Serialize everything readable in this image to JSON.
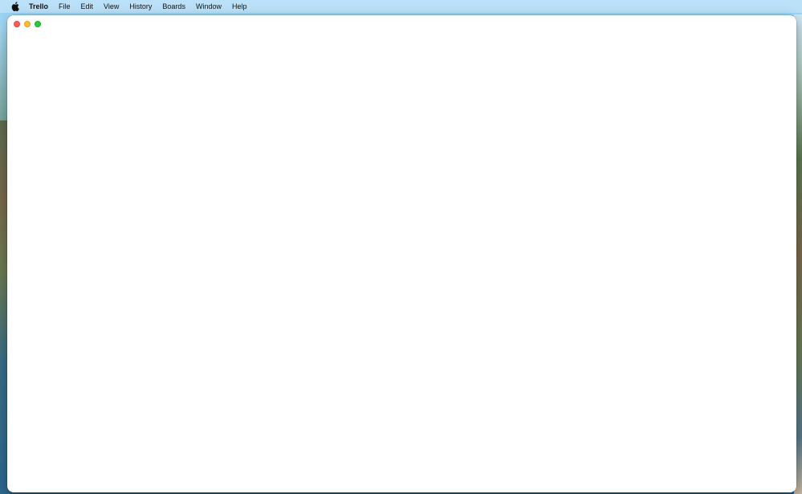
{
  "menubar": {
    "apple_icon": "apple-logo-icon",
    "app_name": "Trello",
    "items": [
      "File",
      "Edit",
      "View",
      "History",
      "Boards",
      "Window",
      "Help"
    ]
  },
  "window": {
    "controls": {
      "close_color": "#ff5f57",
      "minimize_color": "#febc2e",
      "zoom_color": "#28c840"
    }
  }
}
